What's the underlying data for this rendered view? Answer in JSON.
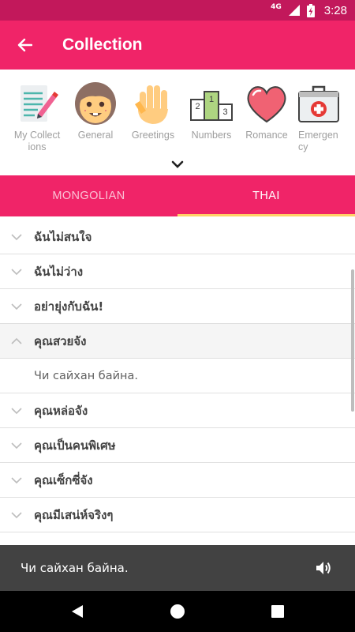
{
  "status_bar": {
    "network": "4G",
    "time": "3:28"
  },
  "app_bar": {
    "title": "Collection",
    "back_icon": "arrow-back-icon"
  },
  "categories": [
    {
      "label": "My Collect ions",
      "icon": "notepad-icon"
    },
    {
      "label": "General",
      "icon": "girl-face-icon"
    },
    {
      "label": "Greetings",
      "icon": "waving-hand-icon"
    },
    {
      "label": "Numbers",
      "icon": "podium-icon"
    },
    {
      "label": "Romance",
      "icon": "heart-icon"
    },
    {
      "label": "Emergen cy",
      "icon": "first-aid-kit-icon"
    }
  ],
  "tabs": [
    {
      "label": "MONGOLIAN",
      "active": false
    },
    {
      "label": "THAI",
      "active": true
    }
  ],
  "phrases": [
    {
      "text": "ฉันไม่สนใจ"
    },
    {
      "text": "ฉันไม่ว่าง"
    },
    {
      "text": "อย่ายุ่งกับฉัน!"
    },
    {
      "text": "คุณสวยจัง",
      "expanded": true,
      "translation": "Чи сайхан байна."
    },
    {
      "text": "คุณหล่อจัง"
    },
    {
      "text": "คุณเป็นคนพิเศษ"
    },
    {
      "text": "คุณเซ็กซี่จัง"
    },
    {
      "text": "คุณมีเสน่ห์จริงๆ"
    }
  ],
  "player": {
    "text": "Чи сайхан байна.",
    "icon": "volume-icon"
  },
  "colors": {
    "primary": "#f02468",
    "primary_dark": "#c2185b",
    "tab_indicator": "#ffd166"
  }
}
